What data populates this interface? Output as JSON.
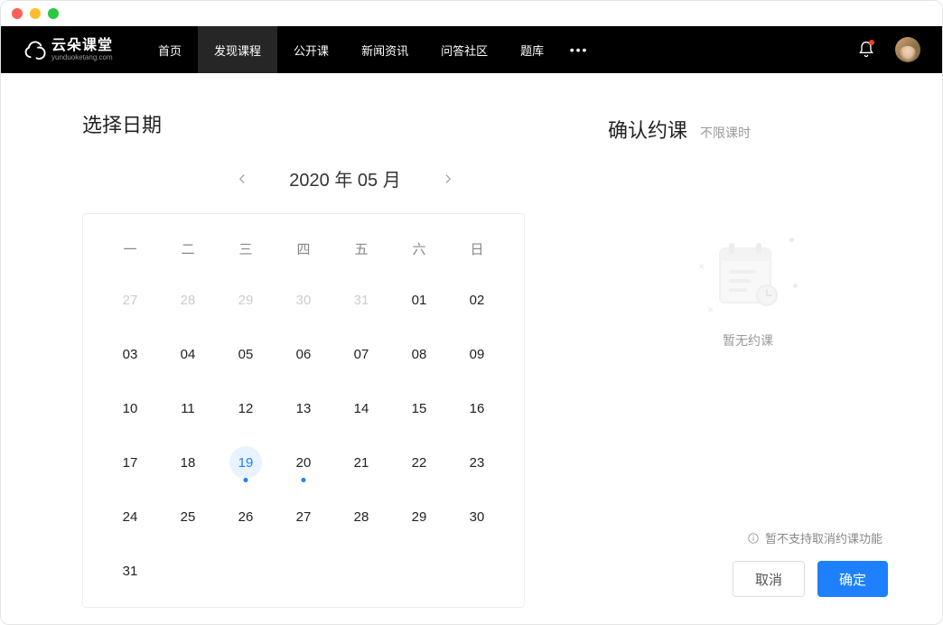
{
  "logo": {
    "cn": "云朵课堂",
    "en": "yunduoketang.com"
  },
  "nav": {
    "items": [
      "首页",
      "发现课程",
      "公开课",
      "新闻资讯",
      "问答社区",
      "题库"
    ],
    "active_index": 1
  },
  "calendar": {
    "title": "选择日期",
    "month_label": "2020 年 05 月",
    "dow": [
      "一",
      "二",
      "三",
      "四",
      "五",
      "六",
      "日"
    ],
    "days": [
      {
        "n": "27",
        "prev": true
      },
      {
        "n": "28",
        "prev": true
      },
      {
        "n": "29",
        "prev": true
      },
      {
        "n": "30",
        "prev": true
      },
      {
        "n": "31",
        "prev": true
      },
      {
        "n": "01"
      },
      {
        "n": "02"
      },
      {
        "n": "03"
      },
      {
        "n": "04"
      },
      {
        "n": "05"
      },
      {
        "n": "06"
      },
      {
        "n": "07"
      },
      {
        "n": "08"
      },
      {
        "n": "09"
      },
      {
        "n": "10"
      },
      {
        "n": "11"
      },
      {
        "n": "12"
      },
      {
        "n": "13"
      },
      {
        "n": "14"
      },
      {
        "n": "15"
      },
      {
        "n": "16"
      },
      {
        "n": "17"
      },
      {
        "n": "18"
      },
      {
        "n": "19",
        "today": true,
        "dot": true
      },
      {
        "n": "20",
        "dot": true
      },
      {
        "n": "21"
      },
      {
        "n": "22"
      },
      {
        "n": "23"
      },
      {
        "n": "24"
      },
      {
        "n": "25"
      },
      {
        "n": "26"
      },
      {
        "n": "27"
      },
      {
        "n": "28"
      },
      {
        "n": "29"
      },
      {
        "n": "30"
      },
      {
        "n": "31"
      }
    ]
  },
  "confirm": {
    "title": "确认约课",
    "subtitle": "不限课时",
    "empty": "暂无约课",
    "notice": "暂不支持取消约课功能",
    "cancel": "取消",
    "ok": "确定"
  },
  "colors": {
    "primary": "#1e80ff"
  }
}
